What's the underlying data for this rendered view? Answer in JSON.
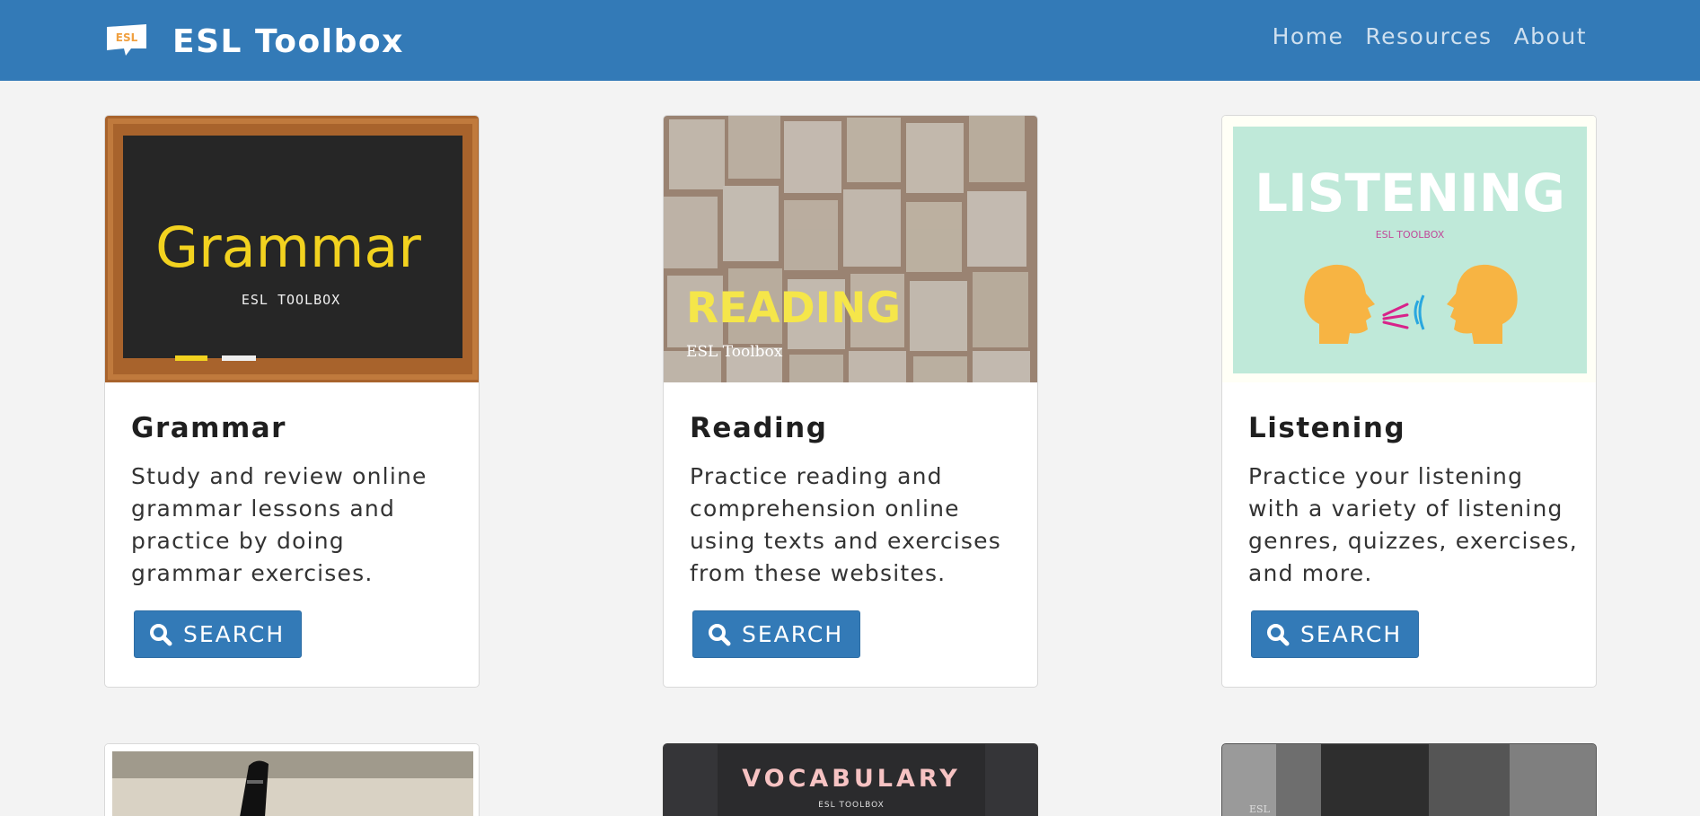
{
  "navbar": {
    "logo_text": "ESL",
    "brand": "ESL Toolbox",
    "links": [
      {
        "label": "Home"
      },
      {
        "label": "Resources"
      },
      {
        "label": "About"
      }
    ]
  },
  "cards": [
    {
      "title": "Grammar",
      "text": "Study and review online grammar lessons and practice by doing grammar exercises.",
      "button": "SEARCH",
      "image": {
        "heading": "Grammar",
        "sub": "ESL TOOLBOX"
      }
    },
    {
      "title": "Reading",
      "text": "Practice reading and comprehension online using texts and exercises from these websites.",
      "button": "SEARCH",
      "image": {
        "heading": "READING",
        "sub": "ESL Toolbox"
      }
    },
    {
      "title": "Listening",
      "text": "Practice your listening with a variety of listening genres, quizzes, exercises, and more.",
      "button": "SEARCH",
      "image": {
        "heading": "LISTENING",
        "sub": "ESL TOOLBOX"
      }
    }
  ],
  "bottom_cards": [
    {
      "image": {
        "heading": "",
        "sub": ""
      }
    },
    {
      "image": {
        "heading": "VOCABULARY",
        "sub": "ESL TOOLBOX"
      }
    },
    {
      "image": {
        "heading": "",
        "sub": "ESL"
      }
    }
  ],
  "colors": {
    "primary": "#337ab7",
    "page_bg": "#f3f3f3",
    "chalk_yellow": "#f2d21f",
    "reading_yellow": "#f5e64a",
    "listening_bg": "#bfe9d9",
    "listening_head": "#f7b443",
    "vocab_pink": "#f7c3c3"
  }
}
